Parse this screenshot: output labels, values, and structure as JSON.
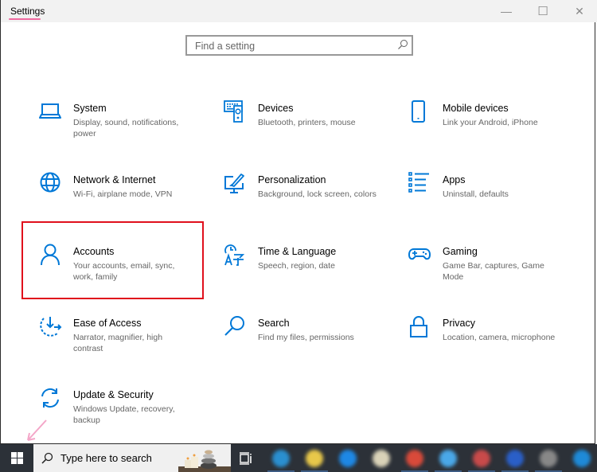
{
  "window": {
    "title": "Settings",
    "controls": {
      "minimize": "—",
      "maximize": "☐",
      "close": "✕"
    }
  },
  "search": {
    "placeholder": "Find a setting",
    "value": ""
  },
  "tiles": [
    {
      "icon": "laptop-icon",
      "name": "System",
      "desc": "Display, sound, notifications, power"
    },
    {
      "icon": "devices-icon",
      "name": "Devices",
      "desc": "Bluetooth, printers, mouse"
    },
    {
      "icon": "phone-icon",
      "name": "Mobile devices",
      "desc": "Link your Android, iPhone"
    },
    {
      "icon": "globe-icon",
      "name": "Network & Internet",
      "desc": "Wi-Fi, airplane mode, VPN"
    },
    {
      "icon": "paint-brush-icon",
      "name": "Personalization",
      "desc": "Background, lock screen, colors"
    },
    {
      "icon": "apps-list-icon",
      "name": "Apps",
      "desc": "Uninstall, defaults"
    },
    {
      "icon": "person-icon",
      "name": "Accounts",
      "desc": "Your accounts, email, sync, work, family"
    },
    {
      "icon": "time-language-icon",
      "name": "Time & Language",
      "desc": "Speech, region, date"
    },
    {
      "icon": "gamepad-icon",
      "name": "Gaming",
      "desc": "Game Bar, captures, Game Mode"
    },
    {
      "icon": "ease-of-access-icon",
      "name": "Ease of Access",
      "desc": "Narrator, magnifier, high contrast"
    },
    {
      "icon": "search-icon",
      "name": "Search",
      "desc": "Find my files, permissions"
    },
    {
      "icon": "lock-icon",
      "name": "Privacy",
      "desc": "Location, camera, microphone"
    },
    {
      "icon": "sync-icon",
      "name": "Update & Security",
      "desc": "Windows Update, recovery, backup"
    }
  ],
  "highlighted_tile": "Accounts",
  "taskbar": {
    "search_text": "Type here to search",
    "apps": [
      {
        "name": "edge-app",
        "color": "#2a8fd0"
      },
      {
        "name": "file-explorer-app",
        "color": "#e8c84a"
      },
      {
        "name": "mail-app",
        "color": "#1e88e5"
      },
      {
        "name": "photos-app",
        "color": "#d9d2b8"
      },
      {
        "name": "chrome-app",
        "color": "#d94a3a"
      },
      {
        "name": "store-app",
        "color": "#4aa8e8"
      },
      {
        "name": "paint-app",
        "color": "#c84a4a"
      },
      {
        "name": "browser-app",
        "color": "#2a5fc8"
      },
      {
        "name": "settings-app",
        "color": "#888888"
      },
      {
        "name": "app-blue",
        "color": "#1e8ad8"
      }
    ]
  },
  "colors": {
    "accent": "#0078d7",
    "highlight_border": "#e0101c",
    "annotation_pink": "#f06aa0"
  }
}
